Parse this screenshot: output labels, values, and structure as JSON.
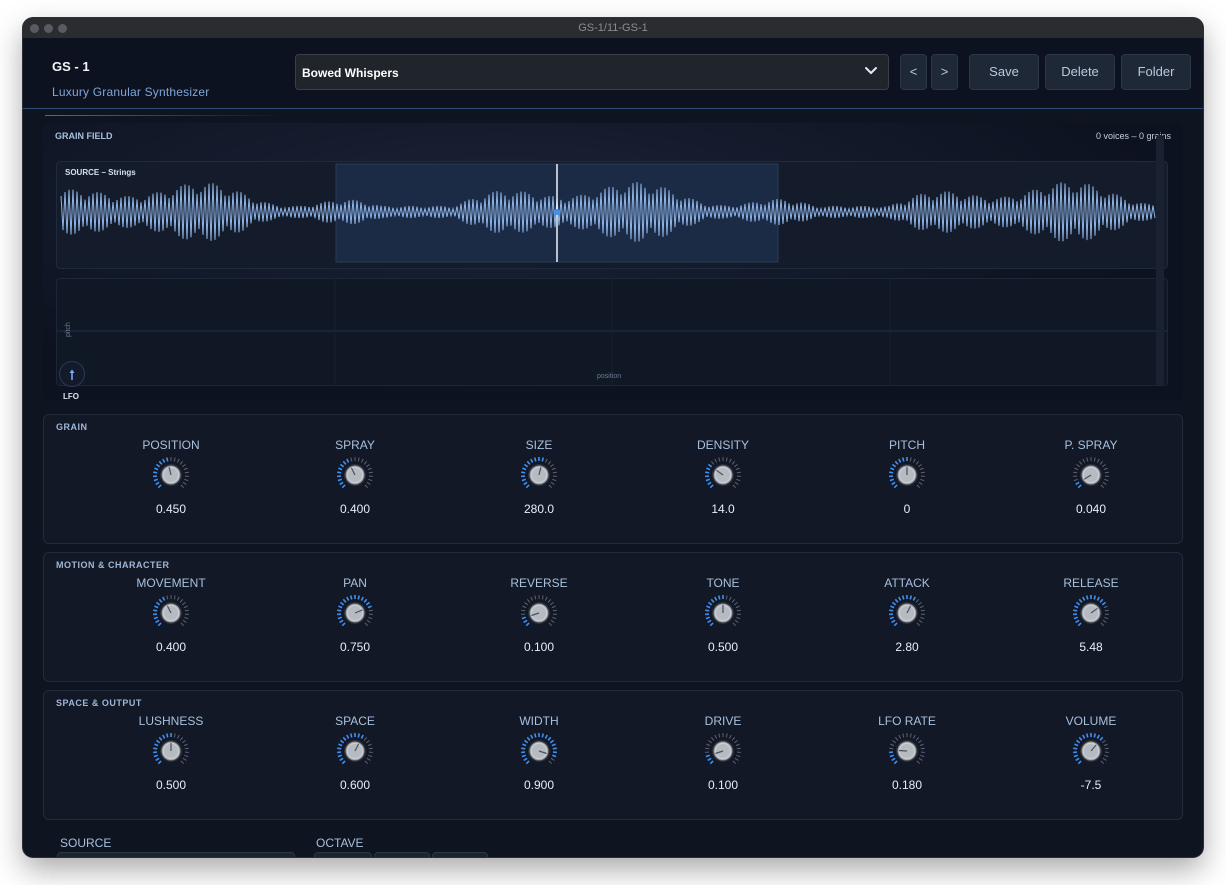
{
  "window": {
    "title": "GS-1/11-GS-1"
  },
  "header": {
    "app_title": "GS - 1",
    "app_subtitle": "Luxury Granular Synthesizer",
    "preset_name": "Bowed Whispers",
    "prev_label": "<",
    "next_label": ">",
    "save_label": "Save",
    "delete_label": "Delete",
    "folder_label": "Folder"
  },
  "grain_field": {
    "title": "GRAIN FIELD",
    "stats": "0 voices  –  0 grains",
    "source_label": "SOURCE – Strings",
    "x_axis_label": "position",
    "y_axis_label": "pitch",
    "lfo_label": "LFO"
  },
  "panels": [
    {
      "title": "GRAIN",
      "knobs": [
        {
          "name": "POSITION",
          "value": "0.450",
          "level": 0.45
        },
        {
          "name": "SPRAY",
          "value": "0.400",
          "level": 0.4
        },
        {
          "name": "SIZE",
          "value": "280.0",
          "level": 0.55
        },
        {
          "name": "DENSITY",
          "value": "14.0",
          "level": 0.3
        },
        {
          "name": "PITCH",
          "value": "0",
          "level": 0.5
        },
        {
          "name": "P. SPRAY",
          "value": "0.040",
          "level": 0.05
        }
      ]
    },
    {
      "title": "MOTION  &  CHARACTER",
      "knobs": [
        {
          "name": "MOVEMENT",
          "value": "0.400",
          "level": 0.4
        },
        {
          "name": "PAN",
          "value": "0.750",
          "level": 0.75
        },
        {
          "name": "REVERSE",
          "value": "0.100",
          "level": 0.1
        },
        {
          "name": "TONE",
          "value": "0.500",
          "level": 0.5
        },
        {
          "name": "ATTACK",
          "value": "2.80",
          "level": 0.6
        },
        {
          "name": "RELEASE",
          "value": "5.48",
          "level": 0.7
        }
      ]
    },
    {
      "title": "SPACE  &  OUTPUT",
      "knobs": [
        {
          "name": "LUSHNESS",
          "value": "0.500",
          "level": 0.5
        },
        {
          "name": "SPACE",
          "value": "0.600",
          "level": 0.6
        },
        {
          "name": "WIDTH",
          "value": "0.900",
          "level": 0.9
        },
        {
          "name": "DRIVE",
          "value": "0.100",
          "level": 0.1
        },
        {
          "name": "LFO RATE",
          "value": "0.180",
          "level": 0.18
        },
        {
          "name": "VOLUME",
          "value": "-7.5",
          "level": 0.65
        }
      ]
    }
  ],
  "bottom": {
    "source_label": "SOURCE",
    "octave_label": "OCTAVE"
  },
  "colors": {
    "accent": "#3f8ff0",
    "waveform": "#8fb4e6",
    "panel": "#121826"
  }
}
